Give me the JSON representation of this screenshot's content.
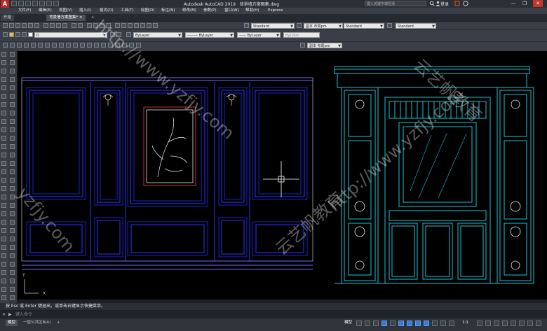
{
  "window": {
    "app_title": "Autodesk AutoCAD 2019",
    "file_title": "背景墙方案图集.dwg",
    "search_placeholder": "键入关键字或短语",
    "login_label": "登录",
    "minimize": "—",
    "restore": "❐",
    "close": "✕"
  },
  "menu": {
    "items": [
      "文件(F)",
      "编辑(E)",
      "视图(V)",
      "插入(I)",
      "格式(O)",
      "工具(T)",
      "绘图(D)",
      "标注(N)",
      "修改(M)",
      "参数(P)",
      "窗口(W)",
      "帮助(H)",
      "Express"
    ]
  },
  "tabs": {
    "start": "开始",
    "drawing": "背景墙方案图集*",
    "close_glyph": "×",
    "add_glyph": "+"
  },
  "toolbar": {
    "text_style_1": "Standard",
    "dim_style": "副本 布局pm",
    "text_style_2": "Standard",
    "table_style": "Standard",
    "layer_value": "0",
    "color_value": "ByLayer",
    "linetype_value": "ByLayer",
    "lineweight_value": "ByLayer",
    "plotstyle_value": "ByColor",
    "mleader_value": "副本 布局pm"
  },
  "command": {
    "history": "按 Esc 或 Enter 键退出，或单击右键显示快捷菜单。",
    "prompt_placeholder": "键入命令"
  },
  "status": {
    "model_tab": "模型",
    "layout_tab": "一层公共区B(A)",
    "model_label": "模型",
    "scale": "1:1",
    "add_layout": "+"
  },
  "colors": {
    "left_wall": "#1a22c8",
    "left_wall_inner": "#2d35ff",
    "right_wall": "#17c3d6",
    "painting_frame": "#c03030"
  },
  "watermarks": [
    "http://www.yzfjy.com",
    "云艺帆教育",
    "yzfjy.com"
  ]
}
